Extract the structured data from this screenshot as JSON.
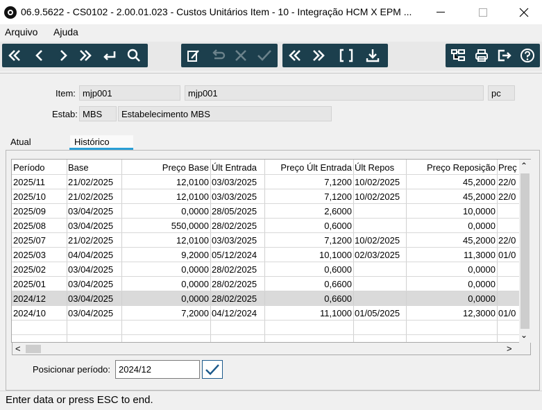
{
  "window": {
    "title": "06.9.5622 - CS0102 - 2.00.01.023 - Custos Unitários Item - 10 - Integração HCM X EPM ...",
    "minimize": "—",
    "maximize": "☐",
    "close": "✕"
  },
  "menu": {
    "items": [
      "Arquivo",
      "Ajuda"
    ]
  },
  "toolbar": {
    "nav_icons": [
      "first-icon",
      "previous-icon",
      "next-icon",
      "last-icon",
      "goto-icon",
      "search-icon"
    ],
    "edit_icons": [
      "edit-icon",
      "undo-icon",
      "delete-icon",
      "confirm-icon"
    ],
    "range_icons": [
      "range-start-icon",
      "range-end-icon",
      "brackets-icon",
      "download-icon"
    ],
    "right_icons": [
      "tree-icon",
      "print-icon",
      "exit-icon",
      "help-icon"
    ],
    "accent_color": "#1c3f4d"
  },
  "header": {
    "item_label": "Item:",
    "item_code": "mjp001",
    "item_desc": "mjp001",
    "item_unit": "pc",
    "estab_label": "Estab:",
    "estab_code": "MBS",
    "estab_desc": "Estabelecimento MBS"
  },
  "tabs": [
    "Atual",
    "Histórico"
  ],
  "active_tab": "Histórico",
  "table": {
    "columns": [
      "Período",
      "Base",
      "Preço Base",
      "Últ Entrada",
      "Preço Últ Entrada",
      "Últ Repos",
      "Preço Reposição",
      "Preç"
    ],
    "rows": [
      [
        "2025/11",
        "21/02/2025",
        "12,0100",
        "03/03/2025",
        "7,1200",
        "10/02/2025",
        "45,2000",
        "22/0"
      ],
      [
        "2025/10",
        "21/02/2025",
        "12,0100",
        "03/03/2025",
        "7,1200",
        "10/02/2025",
        "45,2000",
        "22/0"
      ],
      [
        "2025/09",
        "03/04/2025",
        "0,0000",
        "28/05/2025",
        "2,6000",
        "",
        "10,0000",
        ""
      ],
      [
        "2025/08",
        "03/04/2025",
        "550,0000",
        "28/02/2025",
        "0,6000",
        "",
        "0,0000",
        ""
      ],
      [
        "2025/07",
        "21/02/2025",
        "12,0100",
        "03/03/2025",
        "7,1200",
        "10/02/2025",
        "45,2000",
        "22/0"
      ],
      [
        "2025/03",
        "04/04/2025",
        "9,2000",
        "05/12/2024",
        "10,1000",
        "02/03/2025",
        "11,3000",
        "01/0"
      ],
      [
        "2025/02",
        "03/04/2025",
        "0,0000",
        "28/02/2025",
        "0,6000",
        "",
        "0,0000",
        ""
      ],
      [
        "2025/01",
        "03/04/2025",
        "0,0000",
        "28/02/2025",
        "0,6600",
        "",
        "0,0000",
        ""
      ],
      [
        "2024/12",
        "03/04/2025",
        "0,0000",
        "28/02/2025",
        "0,6600",
        "",
        "0,0000",
        ""
      ],
      [
        "2024/10",
        "03/04/2025",
        "7,2000",
        "04/12/2024",
        "11,1000",
        "01/05/2025",
        "12,3000",
        "01/0"
      ]
    ],
    "selected_row": 8
  },
  "scroll": {
    "up": "⌃",
    "down": "⌄",
    "left": "<",
    "right": ">"
  },
  "position": {
    "label": "Posicionar período:",
    "value": "2024/12"
  },
  "status": "Enter data or press ESC to end."
}
